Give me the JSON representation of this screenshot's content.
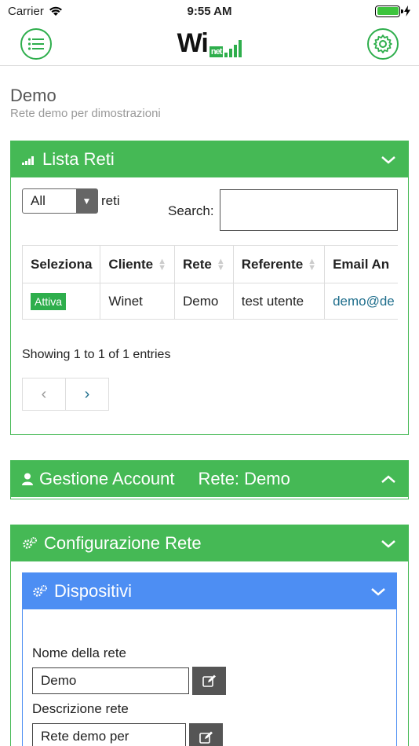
{
  "status": {
    "carrier": "Carrier",
    "time": "9:55 AM"
  },
  "nav": {
    "logo_main": "Wi",
    "logo_sub": "net"
  },
  "page": {
    "title": "Demo",
    "subtitle": "Rete demo per dimostrazioni"
  },
  "lista_reti": {
    "title": "Lista Reti",
    "select_value": "All",
    "select_suffix": "reti",
    "search_label": "Search:",
    "search_value": "",
    "columns": [
      "Seleziona",
      "Cliente",
      "Rete",
      "Referente",
      "Email An"
    ],
    "row": {
      "status": "Attiva",
      "cliente": "Winet",
      "rete": "Demo",
      "referente": "test utente",
      "email": "demo@de"
    },
    "showing": "Showing 1 to 1 of 1 entries",
    "prev": "‹",
    "next": "›"
  },
  "gestione": {
    "title": "Gestione Account",
    "rete": "Rete: Demo"
  },
  "configurazione": {
    "title": "Configurazione Rete"
  },
  "dispositivi": {
    "title": "Dispositivi",
    "nome_label": "Nome della rete",
    "nome_value": "Demo",
    "desc_label": "Descrizione rete",
    "desc_value": "Rete demo per"
  },
  "colors": {
    "green": "#45b955",
    "blue": "#4d8ef3"
  }
}
